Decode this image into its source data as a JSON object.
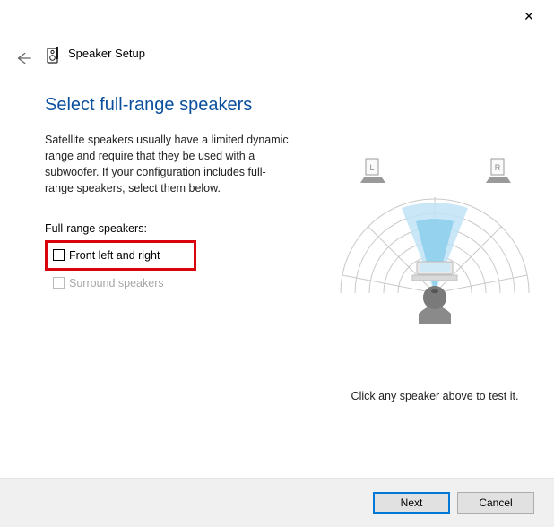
{
  "window": {
    "title": "Speaker Setup",
    "close": "✕"
  },
  "page": {
    "heading": "Select full-range speakers",
    "description": "Satellite speakers usually have a limited dynamic range and require that they be used with a subwoofer.  If your configuration includes full-range speakers, select them below.",
    "section_label": "Full-range speakers:",
    "checkboxes": {
      "front": {
        "label": "Front left and right",
        "checked": false,
        "enabled": true
      },
      "surround": {
        "label": "Surround speakers",
        "checked": false,
        "enabled": false
      }
    },
    "hint": "Click any speaker above to test it."
  },
  "diagram": {
    "left_label": "L",
    "right_label": "R"
  },
  "footer": {
    "next": "Next",
    "cancel": "Cancel"
  }
}
